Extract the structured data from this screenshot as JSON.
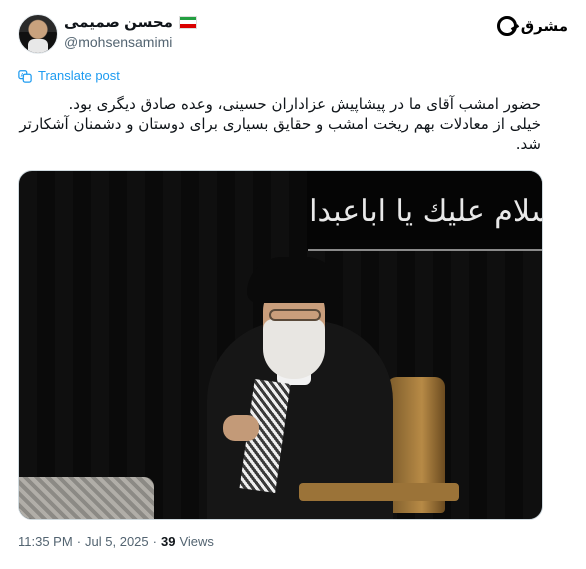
{
  "author": {
    "display_name": "محسن صمیمی",
    "handle": "@mohsensamimi",
    "flag": "iran-flag"
  },
  "brand": {
    "logo_text": "مشرق"
  },
  "translate": {
    "label": "Translate post"
  },
  "post": {
    "lines": [
      "حضور امشب آقای ما در پیشاپیش عزاداران حسینی، وعده صادق دیگری بود.",
      "خیلی از معادلات بهم ریخت امشب و حقایق بسیاری برای دوستان و دشمنان آشکارتر شد."
    ]
  },
  "media": {
    "banner_text": "السلام عليك يا اباعبدالله"
  },
  "meta": {
    "time": "11:35 PM",
    "separator": "·",
    "date": "Jul 5, 2025",
    "separator2": "·",
    "views_count": "39",
    "views_label": "Views"
  },
  "colors": {
    "link": "#1d9bf0",
    "secondary_text": "#536471",
    "primary_text": "#0f1419"
  }
}
